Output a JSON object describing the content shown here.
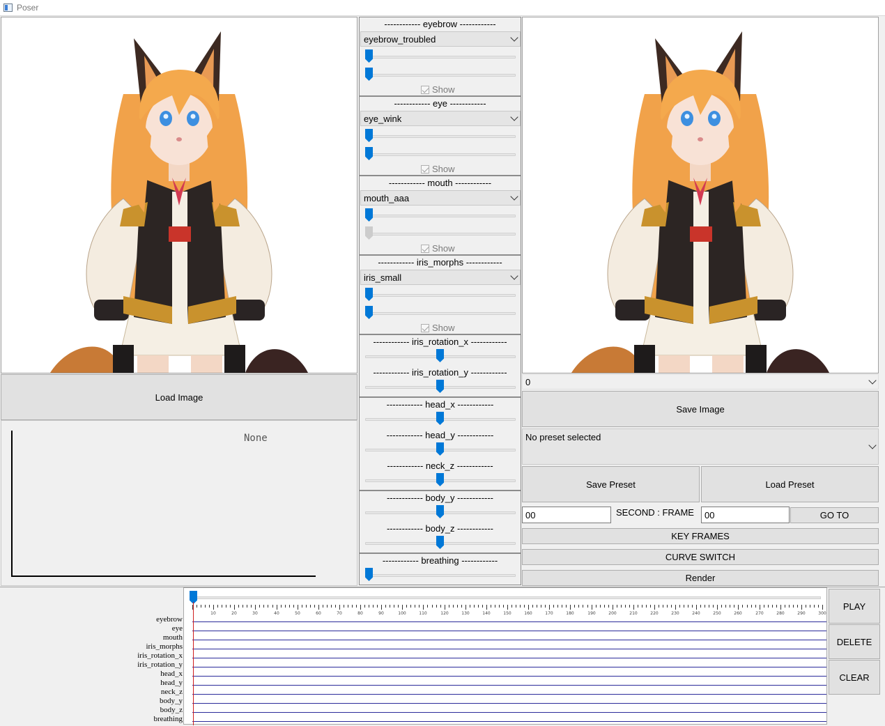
{
  "window": {
    "title": "Poser"
  },
  "left": {
    "load_image_label": "Load Image",
    "plot_placeholder": "None"
  },
  "groups": [
    {
      "label": "------------ eyebrow ------------",
      "combo_value": "eyebrow_troubled",
      "slider_values": [
        0,
        0
      ],
      "show_label": "Show",
      "show_checked": true,
      "second_enabled": true
    },
    {
      "label": "------------ eye ------------",
      "combo_value": "eye_wink",
      "slider_values": [
        0,
        0
      ],
      "show_label": "Show",
      "show_checked": true,
      "second_enabled": true
    },
    {
      "label": "------------ mouth ------------",
      "combo_value": "mouth_aaa",
      "slider_values": [
        0,
        0
      ],
      "show_label": "Show",
      "show_checked": true,
      "second_enabled": false
    },
    {
      "label": "------------ iris_morphs ------------",
      "combo_value": "iris_small",
      "slider_values": [
        0,
        0
      ],
      "show_label": "Show",
      "show_checked": true,
      "second_enabled": true
    }
  ],
  "pose_sliders": {
    "iris_rotation_x": {
      "label": "------------ iris_rotation_x ------------",
      "value": 0.5
    },
    "iris_rotation_y": {
      "label": "------------ iris_rotation_y ------------",
      "value": 0.5
    },
    "head_x": {
      "label": "------------ head_x ------------",
      "value": 0.5
    },
    "head_y": {
      "label": "------------ head_y ------------",
      "value": 0.5
    },
    "neck_z": {
      "label": "------------ neck_z ------------",
      "value": 0.5
    },
    "body_y": {
      "label": "------------ body_y ------------",
      "value": 0.5
    },
    "body_z": {
      "label": "------------ body_z ------------",
      "value": 0.5
    },
    "breathing": {
      "label": "------------ breathing ------------",
      "value": 0
    }
  },
  "right": {
    "output_select": "0",
    "save_image_label": "Save Image",
    "preset_select": "No preset selected",
    "save_preset_label": "Save Preset",
    "load_preset_label": "Load Preset",
    "second_value": "00",
    "second_frame_label": "SECOND : FRAME",
    "frame_value": "00",
    "goto_label": "GO TO",
    "key_frames_label": "KEY FRAMES",
    "curve_switch_label": "CURVE SWITCH",
    "render_label": "Render"
  },
  "timeline": {
    "tracks": [
      "eyebrow",
      "eye",
      "mouth",
      "iris_morphs",
      "iris_rotation_x",
      "iris_rotation_y",
      "head_x",
      "head_y",
      "neck_z",
      "body_y",
      "body_z",
      "breathing"
    ],
    "ticks": [
      "10",
      "20",
      "30",
      "40",
      "50",
      "60",
      "70",
      "80",
      "90",
      "100",
      "110",
      "120",
      "130",
      "140",
      "150",
      "160",
      "170",
      "180",
      "190",
      "200",
      "210",
      "220",
      "230",
      "240",
      "250",
      "260",
      "270",
      "280",
      "290",
      "300"
    ],
    "frame": 0,
    "play_label": "PLAY",
    "delete_label": "DELETE",
    "clear_label": "CLEAR"
  },
  "colors": {
    "accent": "#0078d7",
    "track": "#2a2a9a",
    "cursor": "#d02020"
  }
}
